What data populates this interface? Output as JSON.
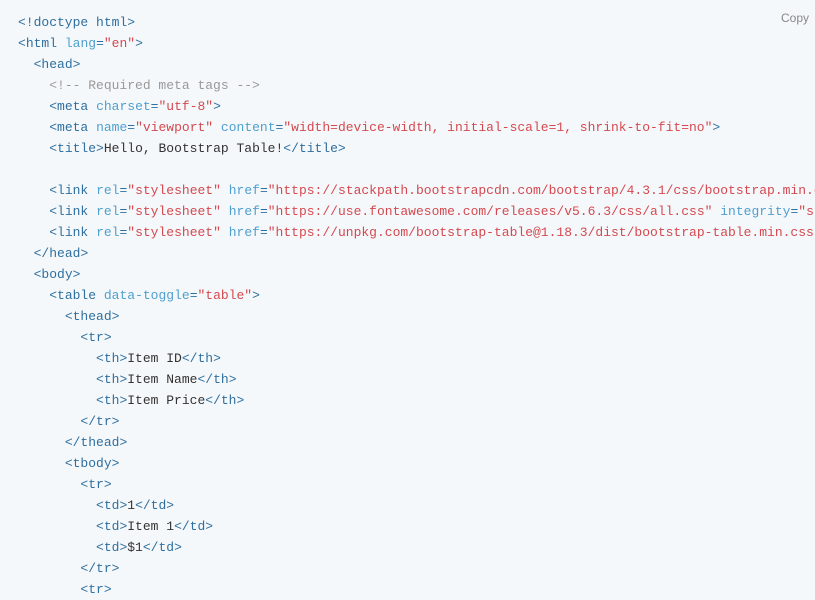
{
  "copy_label": "Copy",
  "code": {
    "doctype": "<!doctype html>",
    "html_open": {
      "tag": "html",
      "attr": "lang",
      "val": "\"en\""
    },
    "head_open": "head",
    "comment": "<!-- Required meta tags -->",
    "meta1": {
      "tag": "meta",
      "at1": "charset",
      "v1": "\"utf-8\""
    },
    "meta2": {
      "tag": "meta",
      "at1": "name",
      "v1": "\"viewport\"",
      "at2": "content",
      "v2": "\"width=device-width, initial-scale=1, shrink-to-fit=no\""
    },
    "title": {
      "tag": "title",
      "text": "Hello, Bootstrap Table!"
    },
    "link1": {
      "tag": "link",
      "at1": "rel",
      "v1": "\"stylesheet\"",
      "at2": "href",
      "v2": "\"https://stackpath.bootstrapcdn.com/bootstrap/4.3.1/css/bootstrap.min.c"
    },
    "link2": {
      "tag": "link",
      "at1": "rel",
      "v1": "\"stylesheet\"",
      "at2": "href",
      "v2": "\"https://use.fontawesome.com/releases/v5.6.3/css/all.css\"",
      "at3": "integrity",
      "v3": "\"sh"
    },
    "link3": {
      "tag": "link",
      "at1": "rel",
      "v1": "\"stylesheet\"",
      "at2": "href",
      "v2": "\"https://unpkg.com/bootstrap-table@1.18.3/dist/bootstrap-table.min.css\""
    },
    "head_close": "/head",
    "body_open": "body",
    "table_open": {
      "tag": "table",
      "at1": "data-toggle",
      "v1": "\"table\""
    },
    "thead_open": "thead",
    "tr": "tr",
    "th": "th",
    "th_close": "/th",
    "th1": "Item ID",
    "th2": "Item Name",
    "th3": "Item Price",
    "tr_close": "/tr",
    "thead_close": "/thead",
    "tbody_open": "tbody",
    "td": "td",
    "td_close": "/td",
    "td1": "1",
    "td2": "Item 1",
    "td3": "$1"
  }
}
